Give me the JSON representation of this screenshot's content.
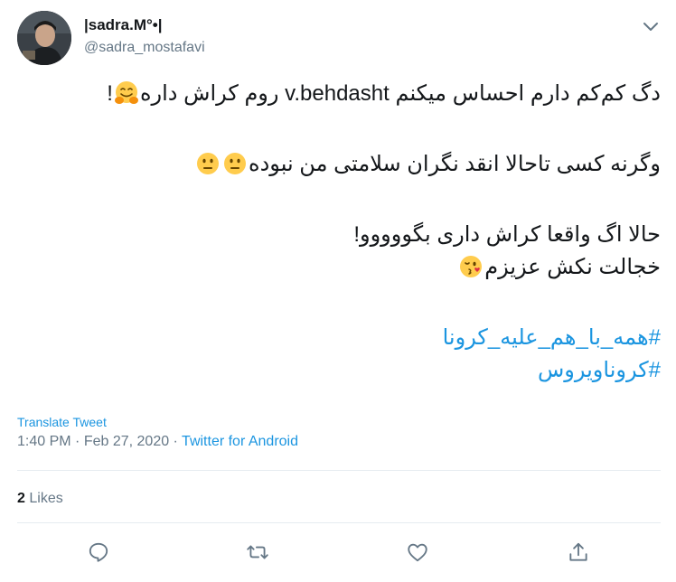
{
  "author": {
    "name": "|sadra.M°•|",
    "handle": "@sadra_mostafavi"
  },
  "tweet": {
    "line1": "دگ کم‌کم دارم احساس میکنم v.behdasht روم کراش داره",
    "line1_end": "!",
    "line2": "وگرنه کسی تاحالا انقد نگران سلامتی من نبوده",
    "line3": "حالا اگ واقعا کراش داری بگووووو!",
    "line4": "خجالت نکش عزیزم",
    "hashtags": [
      "#همه_با_هم_علیه_کرونا",
      "#کروناویروس"
    ]
  },
  "emojis": [
    "hugging-face-icon",
    "neutral-face-icon",
    "neutral-face-icon",
    "face-blowing-kiss-icon"
  ],
  "translate_label": "Translate Tweet",
  "meta": {
    "time": "1:40 PM",
    "separator": " · ",
    "date": "Feb 27, 2020",
    "source": "Twitter for Android"
  },
  "likes": {
    "count": "2",
    "label": "Likes"
  },
  "actions": [
    "reply-icon",
    "retweet-icon",
    "like-icon",
    "share-icon"
  ],
  "colors": {
    "link": "#1b95e0",
    "text": "#14171a",
    "muted": "#657786",
    "divider": "#e6ecf0"
  }
}
